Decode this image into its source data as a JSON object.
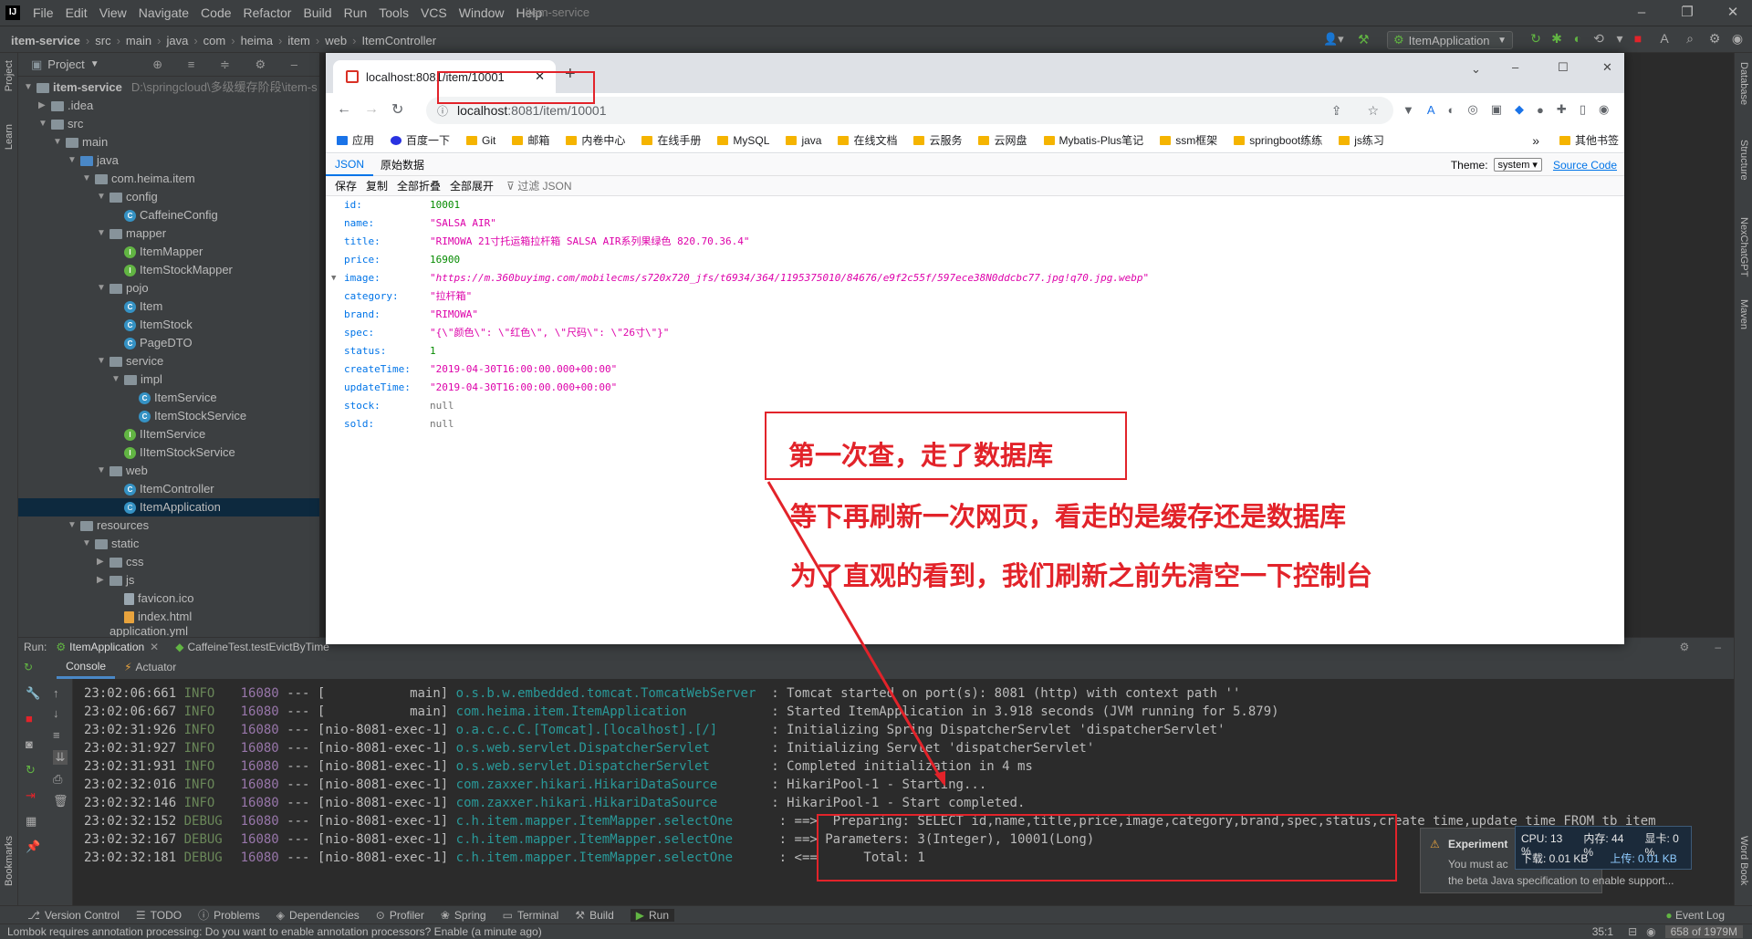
{
  "ide": {
    "menus": [
      "File",
      "Edit",
      "View",
      "Navigate",
      "Code",
      "Refactor",
      "Build",
      "Run",
      "Tools",
      "VCS",
      "Window",
      "Help"
    ],
    "window_title": "item-service",
    "breadcrumbs": [
      "item-service",
      "src",
      "main",
      "java",
      "com",
      "heima",
      "item",
      "web",
      "ItemController"
    ],
    "run_config": "ItemApplication",
    "project_label": "Project",
    "learn_label": "Learn",
    "right_tools": [
      "Database",
      "Structure",
      "NexChatGPT",
      "Maven"
    ],
    "bookmarks_label": "Bookmarks",
    "word_book_label": "Word Book",
    "tree": {
      "root": "item-service",
      "root_path": "D:\\springcloud\\多级缓存阶段\\item-s",
      "idea": ".idea",
      "src": "src",
      "main": "main",
      "java": "java",
      "pkg": "com.heima.item",
      "config": "config",
      "caffeine": "CaffeineConfig",
      "mapper": "mapper",
      "item_mapper": "ItemMapper",
      "item_stock_mapper": "ItemStockMapper",
      "pojo": "pojo",
      "item": "Item",
      "item_stock": "ItemStock",
      "page_dto": "PageDTO",
      "service": "service",
      "impl": "impl",
      "item_service": "ItemService",
      "item_stock_service": "ItemStockService",
      "iitem_service": "IItemService",
      "iitem_stock_service": "IItemStockService",
      "web": "web",
      "item_controller": "ItemController",
      "item_application": "ItemApplication",
      "resources": "resources",
      "static": "static",
      "css": "css",
      "js": "js",
      "favicon": "favicon.ico",
      "index": "index.html",
      "appyml": "application.yml"
    },
    "run": {
      "label": "Run:",
      "tab1": "ItemApplication",
      "tab2": "CaffeineTest.testEvictByTime",
      "console_tab": "Console",
      "actuator_tab": "Actuator"
    },
    "console_lines": [
      {
        "time": "23:02:06:661",
        "level": "INFO",
        "pid": "16080",
        "sep": "---",
        "thread": "[           main]",
        "logger": "o.s.b.w.embedded.tomcat.TomcatWebServer ",
        "msg": ": Tomcat started on port(s): 8081 (http) with context path ''"
      },
      {
        "time": "23:02:06:667",
        "level": "INFO",
        "pid": "16080",
        "sep": "---",
        "thread": "[           main]",
        "logger": "com.heima.item.ItemApplication          ",
        "msg": ": Started ItemApplication in 3.918 seconds (JVM running for 5.879)"
      },
      {
        "time": "23:02:31:926",
        "level": "INFO",
        "pid": "16080",
        "sep": "---",
        "thread": "[nio-8081-exec-1]",
        "logger": "o.a.c.c.C.[Tomcat].[localhost].[/]      ",
        "msg": ": Initializing Spring DispatcherServlet 'dispatcherServlet'"
      },
      {
        "time": "23:02:31:927",
        "level": "INFO",
        "pid": "16080",
        "sep": "---",
        "thread": "[nio-8081-exec-1]",
        "logger": "o.s.web.servlet.DispatcherServlet       ",
        "msg": ": Initializing Servlet 'dispatcherServlet'"
      },
      {
        "time": "23:02:31:931",
        "level": "INFO",
        "pid": "16080",
        "sep": "---",
        "thread": "[nio-8081-exec-1]",
        "logger": "o.s.web.servlet.DispatcherServlet       ",
        "msg": ": Completed initialization in 4 ms"
      },
      {
        "time": "23:02:32:016",
        "level": "INFO",
        "pid": "16080",
        "sep": "---",
        "thread": "[nio-8081-exec-1]",
        "logger": "com.zaxxer.hikari.HikariDataSource      ",
        "msg": ": HikariPool-1 - Starting..."
      },
      {
        "time": "23:02:32:146",
        "level": "INFO",
        "pid": "16080",
        "sep": "---",
        "thread": "[nio-8081-exec-1]",
        "logger": "com.zaxxer.hikari.HikariDataSource      ",
        "msg": ": HikariPool-1 - Start completed."
      },
      {
        "time": "23:02:32:152",
        "level": "DEBUG",
        "pid": "16080",
        "sep": "---",
        "thread": "[nio-8081-exec-1]",
        "logger": "c.h.item.mapper.ItemMapper.selectOne     ",
        "msg": ": ==>  Preparing: SELECT id,name,title,price,image,category,brand,spec,status,create_time,update_time FROM tb_item"
      },
      {
        "time": "23:02:32:167",
        "level": "DEBUG",
        "pid": "16080",
        "sep": "---",
        "thread": "[nio-8081-exec-1]",
        "logger": "c.h.item.mapper.ItemMapper.selectOne     ",
        "msg": ": ==> Parameters: 3(Integer), 10001(Long)"
      },
      {
        "time": "23:02:32:181",
        "level": "DEBUG",
        "pid": "16080",
        "sep": "---",
        "thread": "[nio-8081-exec-1]",
        "logger": "c.h.item.mapper.ItemMapper.selectOne     ",
        "msg": ": <==      Total: 1"
      }
    ],
    "tool_windows": [
      "Version Control",
      "TODO",
      "Problems",
      "Dependencies",
      "Profiler",
      "Spring",
      "Terminal",
      "Build",
      "Run"
    ],
    "event_log": "Event Log",
    "status_message": "Lombok requires annotation processing: Do you want to enable annotation processors? Enable (a minute ago)",
    "caret": "35:1",
    "memory": "658 of 1979M",
    "notification": {
      "title": "Experiment",
      "line1": "You must ac",
      "line2": "the beta Java specification to enable support..."
    },
    "sysmon": {
      "cpu": "CPU: 13 %",
      "mem": "内存: 44 %",
      "gpu": "显卡: 0 %",
      "down": "下载: 0.01 KB",
      "up": "上传: 0.01 KB"
    }
  },
  "browser": {
    "tab_title": "localhost:8081/item/10001",
    "new_tab": "+",
    "url_host": "localhost",
    "url_rest": ":8081/item/10001",
    "bookmarks": [
      "应用",
      "百度一下",
      "Git",
      "邮箱",
      "内卷中心",
      "在线手册",
      "MySQL",
      "java",
      "在线文档",
      "云服务",
      "云网盘",
      "Mybatis-Plus笔记",
      "ssm框架",
      "springboot练练",
      "js练习"
    ],
    "more": "»",
    "other_bookmarks": "其他书签",
    "viewer_tabs": {
      "json": "JSON",
      "raw": "原始数据"
    },
    "theme_label": "Theme:",
    "theme_value": "system",
    "source_code": "Source Code",
    "toolbar": [
      "保存",
      "复制",
      "全部折叠",
      "全部展开"
    ],
    "filter": "过滤 JSON",
    "json": [
      {
        "key": "id:",
        "value": "10001",
        "type": "num"
      },
      {
        "key": "name:",
        "value": "\"SALSA AIR\"",
        "type": "str"
      },
      {
        "key": "title:",
        "value": "\"RIMOWA 21寸托运箱拉杆箱 SALSA AIR系列果绿色 820.70.36.4\"",
        "type": "str"
      },
      {
        "key": "price:",
        "value": "16900",
        "type": "num"
      },
      {
        "key": "image:",
        "value": "\"https://m.360buyimg.com/mobilecms/s720x720_jfs/t6934/364/1195375010/84676/e9f2c55f/597ece38N0ddcbc77.jpg!q70.jpg.webp\"",
        "type": "url"
      },
      {
        "key": "category:",
        "value": "\"拉杆箱\"",
        "type": "str"
      },
      {
        "key": "brand:",
        "value": "\"RIMOWA\"",
        "type": "str"
      },
      {
        "key": "spec:",
        "value": "\"{\\\"颜色\\\": \\\"红色\\\", \\\"尺码\\\": \\\"26寸\\\"}\"",
        "type": "str"
      },
      {
        "key": "status:",
        "value": "1",
        "type": "num"
      },
      {
        "key": "createTime:",
        "value": "\"2019-04-30T16:00:00.000+00:00\"",
        "type": "str"
      },
      {
        "key": "updateTime:",
        "value": "\"2019-04-30T16:00:00.000+00:00\"",
        "type": "str"
      },
      {
        "key": "stock:",
        "value": "null",
        "type": "null"
      },
      {
        "key": "sold:",
        "value": "null",
        "type": "null"
      }
    ]
  },
  "annotation": {
    "line1": "第一次查，走了数据库",
    "line2": "等下再刷新一次网页，看走的是缓存还是数据库",
    "line3": "为了直观的看到，我们刷新之前先清空一下控制台"
  }
}
